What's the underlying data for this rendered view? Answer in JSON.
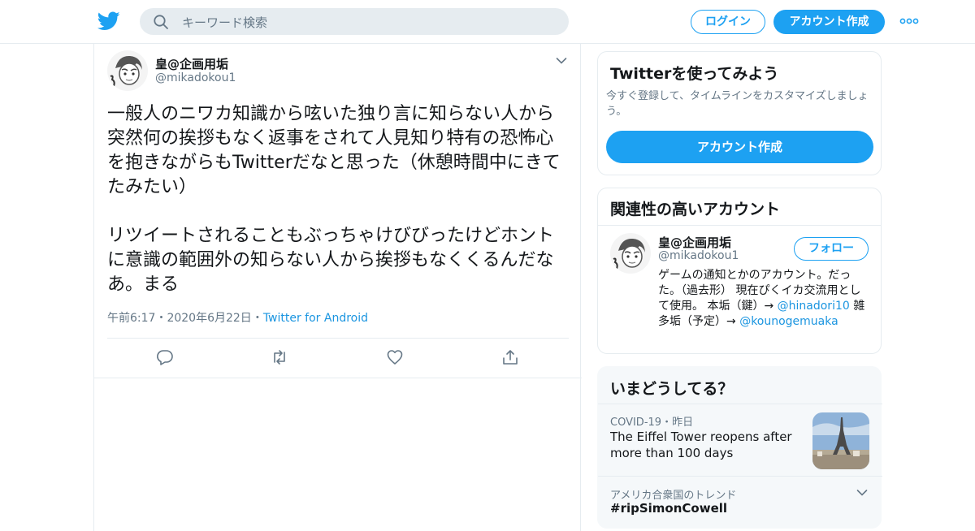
{
  "header": {
    "search_placeholder": "キーワード検索",
    "login_label": "ログイン",
    "signup_label": "アカウント作成",
    "brand_color": "#1da1f2"
  },
  "tweet": {
    "author_name": "皇@企画用垢",
    "author_handle": "@mikadokou1",
    "text_paragraphs": [
      "一般人のニワカ知識から呟いた独り言に知らない人から突然何の挨拶もなく返事をされて人見知り特有の恐怖心を抱きながらもTwitterだなと思った（休憩時間中にきてたみたい）",
      "リツイートされることもぶっちゃけびびったけどホントに意識の範囲外の知らない人から挨拶もなくくるんだなあ。まる"
    ],
    "time": "午前6:17",
    "date": "2020年6月22日",
    "source": "Twitter for Android",
    "separator": "・",
    "actions": [
      "reply-icon",
      "retweet-icon",
      "like-icon",
      "share-icon"
    ]
  },
  "signup_card": {
    "title": "Twitterを使ってみよう",
    "description": "今すぐ登録して、タイムラインをカスタマイズしましょう。",
    "button_label": "アカウント作成"
  },
  "related_card": {
    "title": "関連性の高いアカウント",
    "name": "皇@企画用垢",
    "handle": "@mikadokou1",
    "follow_label": "フォロー",
    "bio_1": "ゲームの通知とかのアカウント。だった。（過去形） 現在ぴくイカ交流用として使用。 本垢（鍵）→ ",
    "mention_1": "@hinadori10",
    "bio_2": " 雑多垢（予定）→ ",
    "mention_2": "@kounogemuaka"
  },
  "trends_card": {
    "title": "いまどうしてる？",
    "trend1_category": "COVID-19",
    "trend1_time": "昨日",
    "trend1_headline": "The Eiffel Tower reopens after more than 100 days",
    "trend2_meta": "アメリカ合衆国のトレンド",
    "trend2_tag": "#ripSimonCowell"
  }
}
